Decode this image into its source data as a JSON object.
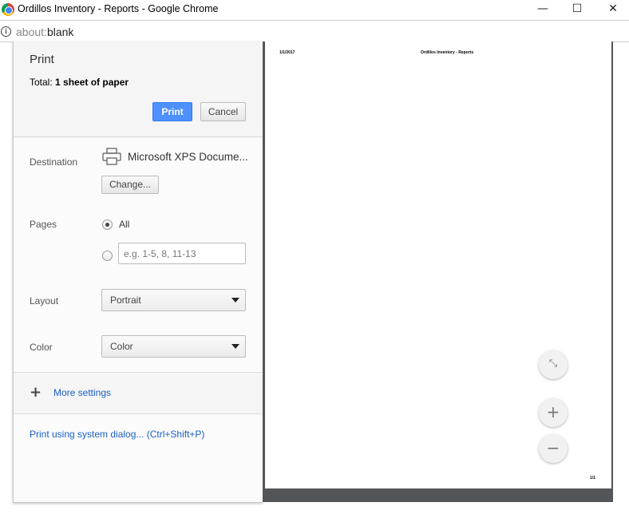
{
  "window": {
    "title": "Ordillos Inventory - Reports - Google Chrome",
    "minimize": "—",
    "maximize": "☐",
    "close": "✕"
  },
  "address": {
    "scheme": "about:",
    "host": "blank"
  },
  "print": {
    "title": "Print",
    "total_label": "Total:",
    "total_value": "1 sheet of paper",
    "print_button": "Print",
    "cancel_button": "Cancel",
    "destination_label": "Destination",
    "destination_value": "Microsoft XPS Docume...",
    "change_button": "Change...",
    "pages_label": "Pages",
    "pages_all": "All",
    "pages_placeholder": "e.g. 1-5, 8, 11-13",
    "layout_label": "Layout",
    "layout_value": "Portrait",
    "color_label": "Color",
    "color_value": "Color",
    "more_settings": "More settings",
    "system_dialog": "Print using system dialog... (Ctrl+Shift+P)",
    "accent": "#4d90fe"
  },
  "preview": {
    "date": "1/1/2017",
    "header": "Ordillos Inventory - Reports",
    "page_number": "1/1"
  }
}
